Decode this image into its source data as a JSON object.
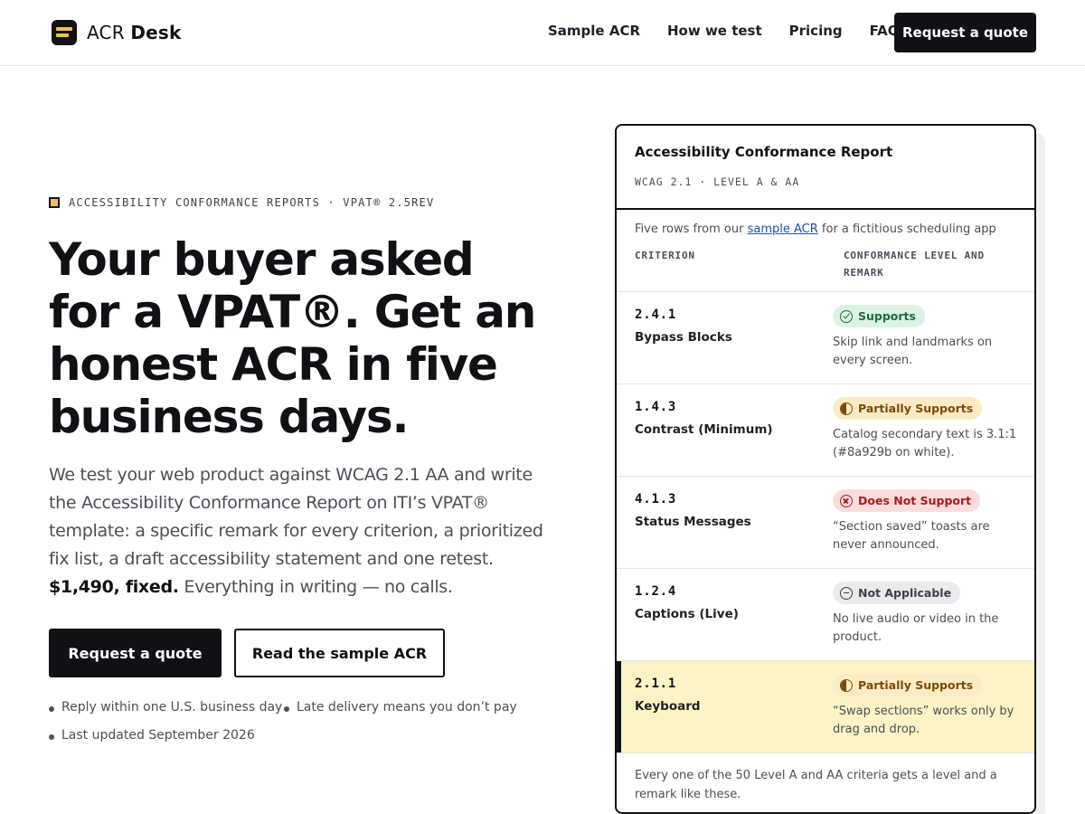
{
  "header": {
    "brand_part1": "ACR",
    "brand_part2": "Desk",
    "nav": [
      "Sample ACR",
      "How we test",
      "Pricing",
      "FAQ"
    ],
    "cta": "Request a quote"
  },
  "hero": {
    "eyebrow": "ACCESSIBILITY CONFORMANCE REPORTS · VPAT® 2.5REV",
    "headline": "Your buyer asked for a VPAT®. Get an honest ACR in five business days.",
    "lede_main": "We test your web product against WCAG 2.1 AA and write the Accessibility Conformance Report on ITI’s VPAT® template: a specific remark for every criterion, a prioritized fix list, a draft accessibility statement and one retest. ",
    "lede_price": "$1,490, fixed.",
    "lede_tail": " Everything in writing — no calls.",
    "primary_button": "Request a quote",
    "secondary_button": "Read the sample ACR",
    "notes": [
      "Reply within one U.S. business day",
      "Late delivery means you don’t pay",
      "Last updated September 2026"
    ]
  },
  "card": {
    "title": "Accessibility Conformance Report",
    "subtitle": "WCAG 2.1 · LEVEL A & AA",
    "intro_before": "Five rows from our ",
    "intro_link": "sample ACR",
    "intro_after": " for a fictitious scheduling app",
    "col_criterion": "CRITERION",
    "col_conformance": "CONFORMANCE LEVEL AND REMARK",
    "rows": [
      {
        "num": "2.4.1",
        "name": "Bypass Blocks",
        "level": "Supports",
        "remark": "Skip link and landmarks on every screen."
      },
      {
        "num": "1.4.3",
        "name": "Contrast (Minimum)",
        "level": "Partially Supports",
        "remark": "Catalog secondary text is 3.1:1 (#8a929b on white)."
      },
      {
        "num": "4.1.3",
        "name": "Status Messages",
        "level": "Does Not Support",
        "remark": "“Section saved” toasts are never announced."
      },
      {
        "num": "1.2.4",
        "name": "Captions (Live)",
        "level": "Not Applicable",
        "remark": "No live audio or video in the product."
      },
      {
        "num": "2.1.1",
        "name": "Keyboard",
        "level": "Partially Supports",
        "remark": "“Swap sections” works only by drag and drop."
      }
    ],
    "footer": "Every one of the 50 Level A and AA criteria gets a level and a remark like these."
  },
  "colors": {
    "accent": "#f2c14e",
    "ink": "#0f1115",
    "supports": "#1d6b3a",
    "partial": "#7a4b05",
    "not_support": "#a31f1f",
    "highlight_row": "#fdf3c4"
  }
}
